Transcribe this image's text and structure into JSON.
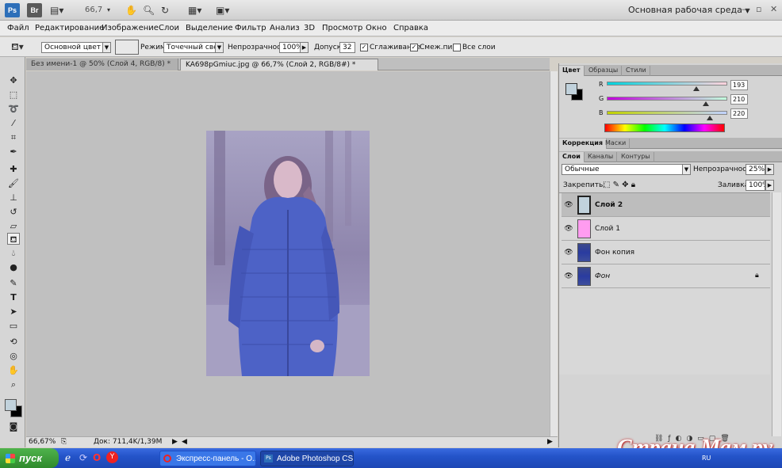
{
  "app": {
    "logo_ps": "Ps",
    "logo_br": "Br",
    "zoom": "66,7",
    "workspace": "Основная рабочая среда"
  },
  "menu": [
    "Файл",
    "Редактирование",
    "Изображение",
    "Слои",
    "Выделение",
    "Фильтр",
    "Анализ",
    "3D",
    "Просмотр",
    "Окно",
    "Справка"
  ],
  "options": {
    "source": "Основной цвет",
    "mode_label": "Режим:",
    "mode_value": "Точечный свет",
    "opacity_label": "Непрозрачность:",
    "opacity_value": "100%",
    "tolerance_label": "Допуск:",
    "tolerance_value": "32",
    "antialias_label": "Сглаживание",
    "contiguous_label": "Смеж.пикс",
    "all_layers_label": "Все слои",
    "antialias_checked": true,
    "contiguous_checked": true,
    "all_layers_checked": false
  },
  "documents": [
    {
      "title": "Без имени-1 @ 50% (Слой 4, RGB/8) *",
      "active": false
    },
    {
      "title": "KA698pGmiuc.jpg @ 66,7% (Слой 2, RGB/8#) *",
      "active": true
    }
  ],
  "status": {
    "zoom": "66,67%",
    "doc": "Док: 711,4K/1,39M"
  },
  "color_panel": {
    "tabs": [
      "Цвет",
      "Образцы",
      "Стили"
    ],
    "r_label": "R",
    "g_label": "G",
    "b_label": "B",
    "r": "193",
    "g": "210",
    "b": "220",
    "foreground": "#c1d2dc",
    "background": "#000000"
  },
  "adjust_panel": {
    "tabs": [
      "Коррекция",
      "Маски"
    ]
  },
  "layers_panel": {
    "tabs": [
      "Слои",
      "Каналы",
      "Контуры"
    ],
    "blend_mode": "Обычные",
    "opacity_label": "Непрозрачность:",
    "opacity_value": "25%",
    "lock_label": "Закрепить:",
    "fill_label": "Заливка:",
    "fill_value": "100%",
    "layers": [
      {
        "name": "Слой 2",
        "selected": true,
        "thumb": "light-blue"
      },
      {
        "name": "Слой 1",
        "selected": false,
        "thumb": "pink"
      },
      {
        "name": "Фон копия",
        "selected": false,
        "thumb": "photo"
      },
      {
        "name": "Фон",
        "selected": false,
        "thumb": "photo",
        "locked": true
      }
    ]
  },
  "taskbar": {
    "start": "пуск",
    "tasks": [
      "Экспресс-панель - О...",
      "Adobe Photoshop CS..."
    ],
    "tray_lang": "RU"
  },
  "watermark": "Страна Мам.ру"
}
